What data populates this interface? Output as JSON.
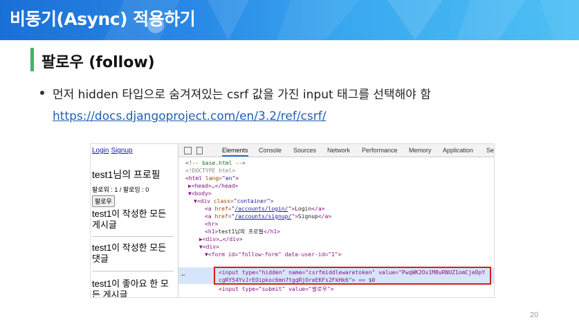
{
  "slide": {
    "title": "비동기(Async) 적용하기",
    "section_heading": "팔로우 (follow)",
    "bullet_text": "먼저 hidden 타입으로 숨겨져있는 csrf 값을 가진 input 태그를 선택해야 함",
    "bullet_link": "https://docs.djangoproject.com/en/3.2/ref/csrf/",
    "page_number": "20"
  },
  "colors": {
    "banner_start": "#1a6fd6",
    "banner_end": "#4fc0f4",
    "accent_bar": "#3cb66b",
    "link": "#1f5fb3",
    "highlight_border": "#d02020"
  },
  "browser_page": {
    "login_link": "Login",
    "signup_link": "Signup",
    "profile_heading": "test1님의 프로필",
    "follow_counts": "팔로워 : 1 / 팔로잉 : 0",
    "follow_button": "팔로우",
    "articles_heading": "test1이 작성한 모든 게시글",
    "comments_heading": "test1이 작성한 모든 댓글",
    "likes_heading": "test1이 좋아요 한 모든 게시글"
  },
  "devtools": {
    "tabs": [
      "Elements",
      "Console",
      "Sources",
      "Network",
      "Performance",
      "Memory",
      "Application",
      "Se"
    ],
    "active_tab": "Elements",
    "lines": {
      "l1_comment": "<!-- base.html -->",
      "l2_doctype": "<!DOCTYPE html>",
      "l3_html_open": "<html ",
      "l3_attr": "lang=",
      "l3_val": "\"en\"",
      "l3_close": ">",
      "l4": "▶<head>…</head>",
      "l5": "▼<body>",
      "l6_open": "▼<div ",
      "l6_attr": "class=",
      "l6_val": "\"container\"",
      "l6_close": ">",
      "l7_open": "<a ",
      "l7_attr": "href=",
      "l7_val": "/accounts/login/",
      "l7_text": "Login",
      "l8_open": "<a ",
      "l8_attr": "href=",
      "l8_val": "/accounts/signup/",
      "l8_text": "Signup",
      "l9": "<hr>",
      "l10_open": "<h1>",
      "l10_text": "test1님의 프로필",
      "l10_close": "</h1>",
      "l11": "▶<div>…</div>",
      "l12": "▼<div>",
      "l13": "▼<form id=\"follow-form\" data-user-id=\"1\">",
      "sel_line1": "<input type=\"hidden\" name=\"csrfmiddlewaretoken\" value=\"PwqWK2Ox1M8uRNUZ1omCjeDpY",
      "sel_line2": "cgRY54YvJrEOipkoc6mn7tgqRjOreEKFs2FkHk6\"> == $0",
      "l15": "<input type=\"submit\" value=\"팔로우\">",
      "ellipsis": "…"
    }
  }
}
